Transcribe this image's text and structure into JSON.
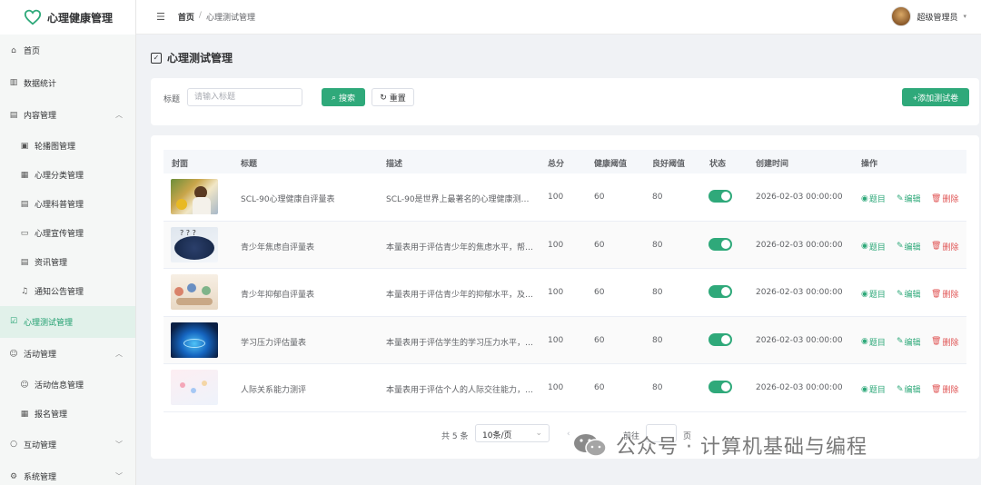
{
  "app": {
    "title": "心理健康管理"
  },
  "sidebar": {
    "items": [
      {
        "label": "首页",
        "icon": "home-icon"
      },
      {
        "label": "数据统计",
        "icon": "bar-chart-icon"
      },
      {
        "label": "内容管理",
        "icon": "book-icon"
      },
      {
        "label": "轮播图管理",
        "icon": "image-icon"
      },
      {
        "label": "心理分类管理",
        "icon": "grid-icon"
      },
      {
        "label": "心理科普管理",
        "icon": "book-icon"
      },
      {
        "label": "心理宣传管理",
        "icon": "chat-icon"
      },
      {
        "label": "资讯管理",
        "icon": "news-icon"
      },
      {
        "label": "通知公告管理",
        "icon": "bell-icon"
      },
      {
        "label": "心理测试管理",
        "icon": "checkbox-icon"
      },
      {
        "label": "活动管理",
        "icon": "users-icon"
      },
      {
        "label": "活动信息管理",
        "icon": "users-icon"
      },
      {
        "label": "报名管理",
        "icon": "calendar-icon"
      },
      {
        "label": "互动管理",
        "icon": "chat-icon"
      },
      {
        "label": "系统管理",
        "icon": "gear-icon"
      }
    ]
  },
  "header": {
    "breadcrumb_home": "首页",
    "breadcrumb_sep": "/",
    "breadcrumb_current": "心理测试管理",
    "user_name": "超级管理员"
  },
  "page": {
    "title": "心理测试管理"
  },
  "search": {
    "label": "标题",
    "placeholder": "请输入标题",
    "search_button": "搜索",
    "reset_button": "重置",
    "add_button": "+添加测试卷"
  },
  "table": {
    "columns": [
      "封面",
      "标题",
      "描述",
      "总分",
      "健康阈值",
      "良好阈值",
      "状态",
      "创建时间",
      "操作"
    ],
    "rows": [
      {
        "title": "SCL-90心理健康自评量表",
        "desc": "SCL-90是世界上最著名的心理健康测…",
        "total": "100",
        "healthy": "60",
        "good": "80",
        "status": true,
        "created": "2026-02-03 00:00:00"
      },
      {
        "title": "青少年焦虑自评量表",
        "desc": "本量表用于评估青少年的焦虑水平，帮…",
        "total": "100",
        "healthy": "60",
        "good": "80",
        "status": true,
        "created": "2026-02-03 00:00:00"
      },
      {
        "title": "青少年抑郁自评量表",
        "desc": "本量表用于评估青少年的抑郁水平，及…",
        "total": "100",
        "healthy": "60",
        "good": "80",
        "status": true,
        "created": "2026-02-03 00:00:00"
      },
      {
        "title": "学习压力评估量表",
        "desc": "本量表用于评估学生的学习压力水平，…",
        "total": "100",
        "healthy": "60",
        "good": "80",
        "status": true,
        "created": "2026-02-03 00:00:00"
      },
      {
        "title": "人际关系能力测评",
        "desc": "本量表用于评估个人的人际交往能力，…",
        "total": "100",
        "healthy": "60",
        "good": "80",
        "status": true,
        "created": "2026-02-03 00:00:00"
      }
    ],
    "actions": {
      "questions": "题目",
      "edit": "编辑",
      "delete": "删除"
    }
  },
  "pagination": {
    "total": "共 5 条",
    "page_size": "10条/页",
    "goto": "前往",
    "page_suffix": "页"
  },
  "watermark": {
    "text": "公众号 · 计算机基础与编程"
  },
  "colors": {
    "primary": "#2fa97a",
    "danger": "#e05555",
    "active_bg": "#e1f1ea"
  }
}
